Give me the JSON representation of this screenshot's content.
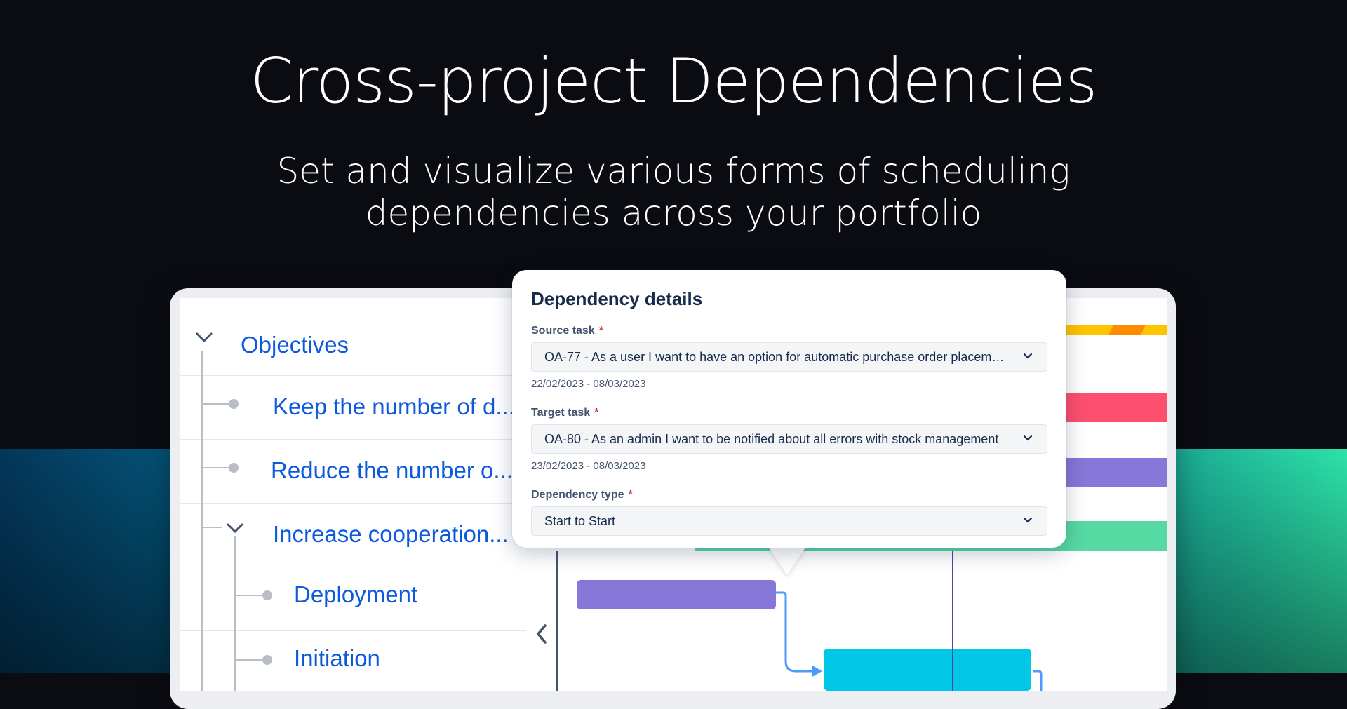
{
  "hero": {
    "title": "Cross-project Dependencies",
    "subtitle_line1": "Set and visualize various forms of scheduling",
    "subtitle_line2": "dependencies across your portfolio"
  },
  "tree": {
    "items": [
      {
        "label": "Objectives"
      },
      {
        "label": "Keep the number of d..."
      },
      {
        "label": "Reduce the number o..."
      },
      {
        "label": "Increase cooperation..."
      },
      {
        "label": "Deployment"
      },
      {
        "label": "Initiation"
      }
    ]
  },
  "popover": {
    "title": "Dependency details",
    "source_label": "Source task",
    "source_value": "OA-77 - As a user I want to have an option for automatic purchase order placement",
    "source_dates": "22/02/2023 - 08/03/2023",
    "target_label": "Target task",
    "target_value": "OA-80 - As an admin I want to be notified about all errors with stock management",
    "target_dates": "23/02/2023 - 08/03/2023",
    "type_label": "Dependency type",
    "type_value": "Start to Start",
    "required_mark": "*"
  },
  "colors": {
    "link_blue": "#0c5adb",
    "bar_yellow": "#ffc400",
    "bar_orange": "#ff8b00",
    "bar_red": "#ff4f6f",
    "bar_purple": "#8777d9",
    "bar_green": "#57d9a3",
    "bar_cyan": "#00c7e6",
    "dependency_arrow": "#4c9aff"
  }
}
